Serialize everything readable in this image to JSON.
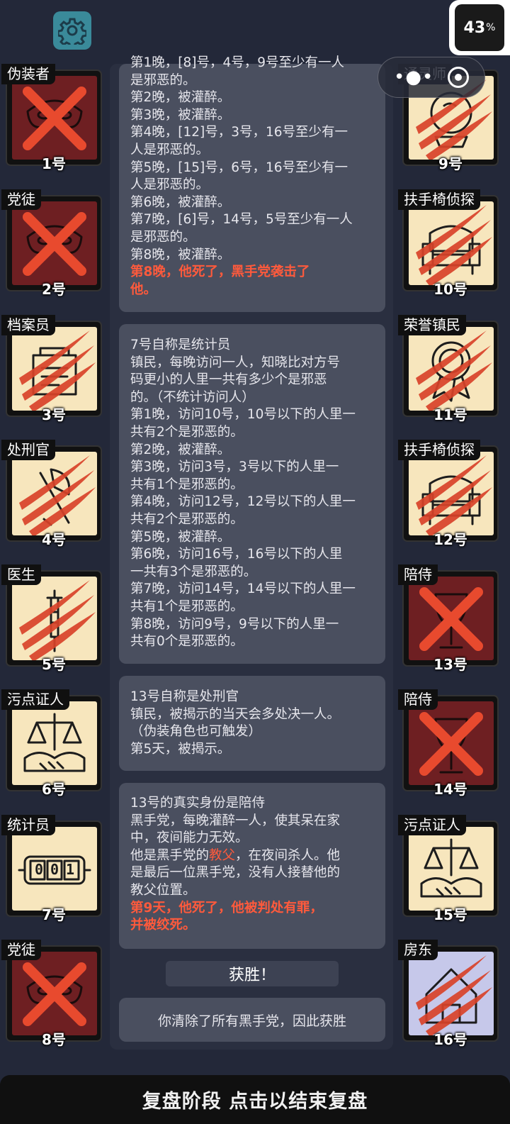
{
  "topbar": {
    "settings_icon": "gear-icon",
    "battery_value": "43",
    "battery_unit": "%"
  },
  "colors": {
    "background": "#232839",
    "log_box": "#4a4f5f",
    "highlight_red": "#ff5a3c",
    "dead_tile": "#6e1f22",
    "alive_tile": "#f7e6bd",
    "landlord_tile": "#c6c8ea",
    "settings_teal": "#3a8a9a"
  },
  "players_left": [
    {
      "role": "伪装者",
      "number": "1号",
      "tile": "dark",
      "mark": "x",
      "icon": "mask-icon"
    },
    {
      "role": "党徒",
      "number": "2号",
      "tile": "dark",
      "mark": "x",
      "icon": "mask-icon"
    },
    {
      "role": "档案员",
      "number": "3号",
      "tile": "light",
      "mark": "claw",
      "icon": "archive-icon"
    },
    {
      "role": "处刑官",
      "number": "4号",
      "tile": "light",
      "mark": "claw",
      "icon": "axe-icon"
    },
    {
      "role": "医生",
      "number": "5号",
      "tile": "light",
      "mark": "claw",
      "icon": "syringe-icon"
    },
    {
      "role": "污点证人",
      "number": "6号",
      "tile": "light",
      "mark": "none",
      "icon": "scales-handshake-icon"
    },
    {
      "role": "统计员",
      "number": "7号",
      "tile": "light",
      "mark": "none",
      "icon": "counter-icon",
      "counter": "001"
    },
    {
      "role": "党徒",
      "number": "8号",
      "tile": "dark",
      "mark": "x",
      "icon": "mask-icon"
    }
  ],
  "players_right": [
    {
      "role": "通灵师",
      "number": "9号",
      "tile": "light",
      "mark": "claw",
      "icon": "crystal-ball-icon"
    },
    {
      "role": "扶手椅侦探",
      "number": "10号",
      "tile": "light",
      "mark": "claw",
      "icon": "armchair-icon"
    },
    {
      "role": "荣誉镇民",
      "number": "11号",
      "tile": "light",
      "mark": "claw",
      "icon": "medal-icon"
    },
    {
      "role": "扶手椅侦探",
      "number": "12号",
      "tile": "light",
      "mark": "claw",
      "icon": "armchair-icon"
    },
    {
      "role": "陪侍",
      "number": "13号",
      "tile": "dark",
      "mark": "x",
      "icon": "wine-glass-icon"
    },
    {
      "role": "陪侍",
      "number": "14号",
      "tile": "dark",
      "mark": "x",
      "icon": "wine-glass-icon"
    },
    {
      "role": "污点证人",
      "number": "15号",
      "tile": "light",
      "mark": "none",
      "icon": "scales-handshake-icon"
    },
    {
      "role": "房东",
      "number": "16号",
      "tile": "lav",
      "mark": "claw",
      "icon": "house-icon"
    }
  ],
  "log1": {
    "lines": [
      "第1晚，[8]号，4号，9号至少有一人",
      "是邪恶的。",
      "第2晚，被灌醉。",
      "第3晚，被灌醉。",
      "第4晚，[12]号，3号，16号至少有一",
      "人是邪恶的。",
      "第5晚，[15]号，6号，16号至少有一",
      "人是邪恶的。",
      "第6晚，被灌醉。",
      "第7晚，[6]号，14号，5号至少有一人",
      "是邪恶的。",
      "第8晚，被灌醉。"
    ],
    "death_1": "第8晚，他死了，黑手党袭击了",
    "death_2": "他。"
  },
  "log2": {
    "lines": [
      "7号自称是统计员",
      "镇民，每晚访问一人，知晓比对方号",
      "码更小的人里一共有多少个是邪恶",
      "的。（不统计访问人）",
      "第1晚，访问10号，10号以下的人里一",
      "共有2个是邪恶的。",
      "第2晚，被灌醉。",
      "第3晚，访问3号，3号以下的人里一",
      "共有1个是邪恶的。",
      "第4晚，访问12号，12号以下的人里一",
      "共有2个是邪恶的。",
      "第5晚，被灌醉。",
      "第6晚，访问16号，16号以下的人里",
      "一共有3个是邪恶的。",
      "第7晚，访问14号，14号以下的人里一",
      "共有1个是邪恶的。",
      "第8晚，访问9号，9号以下的人里一",
      "共有0个是邪恶的。"
    ]
  },
  "log3": {
    "lines": [
      "13号自称是处刑官",
      "镇民，被揭示的当天会多处决一人。",
      "（伪装角色也可触发）",
      "第5天，被揭示。"
    ]
  },
  "log4": {
    "line1": "13号的真实身份是陪侍",
    "line2": "黑手党，每晚灌醉一人，使其呆在家",
    "line3": "中，夜间能力无效。",
    "line4_pre": "他是黑手党的",
    "line4_em": "教父",
    "line4_post": "，在夜间杀人。他",
    "line5": "是最后一位黑手党，没有人接替他的",
    "line6": "教父位置。",
    "death_1": "第9天，他死了，他被判处有罪，",
    "death_2": "并被绞死。"
  },
  "victory": {
    "title": "获胜！",
    "message": "你清除了所有黑手党，因此获胜"
  },
  "footer": {
    "label": "复盘阶段 点击以结束复盘"
  }
}
